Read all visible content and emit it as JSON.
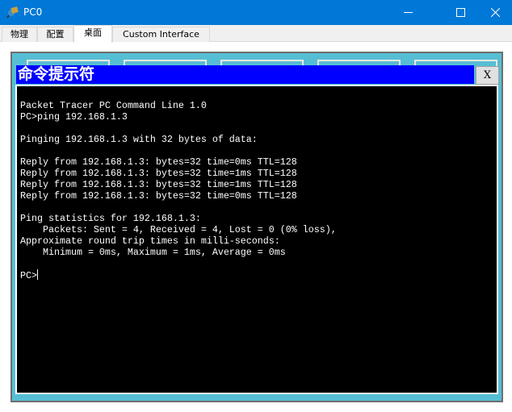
{
  "window": {
    "title": "PC0",
    "icon": "packet-tracer-pc-icon",
    "controls": [
      "minimize-icon",
      "maximize-icon",
      "close-icon"
    ]
  },
  "tabs": [
    {
      "label": "物理"
    },
    {
      "label": "配置"
    },
    {
      "label": "桌面",
      "active": true
    },
    {
      "label": "Custom Interface"
    }
  ],
  "command_prompt": {
    "title": "命令提示符",
    "close_label": "X",
    "lines": [
      "Packet Tracer PC Command Line 1.0",
      "PC>ping 192.168.1.3",
      "",
      "Pinging 192.168.1.3 with 32 bytes of data:",
      "",
      "Reply from 192.168.1.3: bytes=32 time=0ms TTL=128",
      "Reply from 192.168.1.3: bytes=32 time=1ms TTL=128",
      "Reply from 192.168.1.3: bytes=32 time=1ms TTL=128",
      "Reply from 192.168.1.3: bytes=32 time=0ms TTL=128",
      "",
      "Ping statistics for 192.168.1.3:",
      "    Packets: Sent = 4, Received = 4, Lost = 0 (0% loss),",
      "Approximate round trip times in milli-seconds:",
      "    Minimum = 0ms, Maximum = 1ms, Average = 0ms",
      ""
    ],
    "prompt": "PC>"
  },
  "colors": {
    "titlebar": "#0078d7",
    "desktop": "#56bed4",
    "cmd_title": "#0000ff",
    "terminal_bg": "#000000"
  }
}
